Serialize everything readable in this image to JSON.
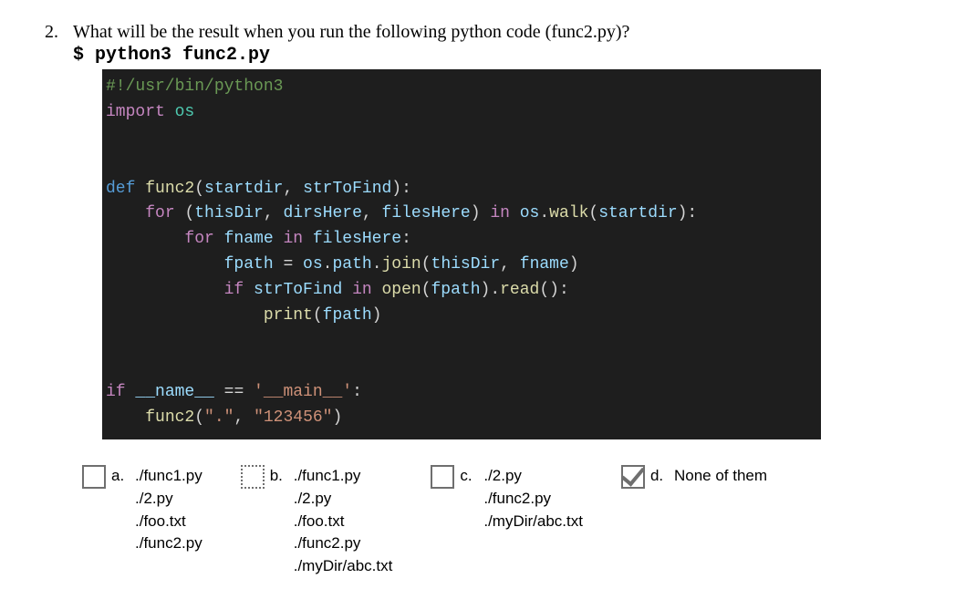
{
  "question": {
    "number": "2.",
    "text": "What will be the result when you run the following python code (func2.py)?",
    "command": "$ python3 func2.py"
  },
  "code": {
    "l1_shebang": "#!/usr/bin/python3",
    "l2_import": "import",
    "l2_os": "os",
    "l3_def": "def",
    "l3_fn": "func2",
    "l3_sig_open": "(",
    "l3_p1": "startdir",
    "l3_comma1": ", ",
    "l3_p2": "strToFind",
    "l3_sig_close": "):",
    "l4_for": "for",
    "l4_open": "(",
    "l4_v1": "thisDir",
    "l4_c1": ", ",
    "l4_v2": "dirsHere",
    "l4_c2": ", ",
    "l4_v3": "filesHere",
    "l4_close": ") ",
    "l4_in": "in",
    "l4_os": " os",
    "l4_dot": ".",
    "l4_walk": "walk",
    "l4_arg": "(",
    "l4_startdir": "startdir",
    "l4_end": "):",
    "l5_for": "for",
    "l5_fname": " fname ",
    "l5_in": "in",
    "l5_files": " filesHere",
    "l5_colon": ":",
    "l6_fpath": "fpath",
    "l6_eq": " = ",
    "l6_os": "os",
    "l6_d1": ".",
    "l6_path": "path",
    "l6_d2": ".",
    "l6_join": "join",
    "l6_open": "(",
    "l6_a1": "thisDir",
    "l6_c": ", ",
    "l6_a2": "fname",
    "l6_close": ")",
    "l7_if": "if",
    "l7_str": " strToFind ",
    "l7_in": "in",
    "l7_open": " open",
    "l7_p1": "(",
    "l7_fpath": "fpath",
    "l7_p2": ").",
    "l7_read": "read",
    "l7_end": "():",
    "l8_print": "print",
    "l8_open": "(",
    "l8_fpath": "fpath",
    "l8_close": ")",
    "l9_if": "if",
    "l9_name": " __name__ ",
    "l9_eq": "== ",
    "l9_main": "'__main__'",
    "l9_colon": ":",
    "l10_fn": "func2",
    "l10_open": "(",
    "l10_s1": "\".\"",
    "l10_c": ", ",
    "l10_s2": "\"123456\"",
    "l10_close": ")"
  },
  "options": {
    "a": {
      "letter": "a.",
      "lines": [
        "./func1.py",
        "./2.py",
        "./foo.txt",
        "./func2.py"
      ],
      "checked": false,
      "dotted": false
    },
    "b": {
      "letter": "b.",
      "lines": [
        "./func1.py",
        "./2.py",
        "./foo.txt",
        "./func2.py",
        "./myDir/abc.txt"
      ],
      "checked": false,
      "dotted": true
    },
    "c": {
      "letter": "c.",
      "lines": [
        "./2.py",
        "./func2.py",
        "./myDir/abc.txt"
      ],
      "checked": false,
      "dotted": false
    },
    "d": {
      "letter": "d.",
      "text": "None of them",
      "checked": true,
      "dotted": false
    }
  }
}
